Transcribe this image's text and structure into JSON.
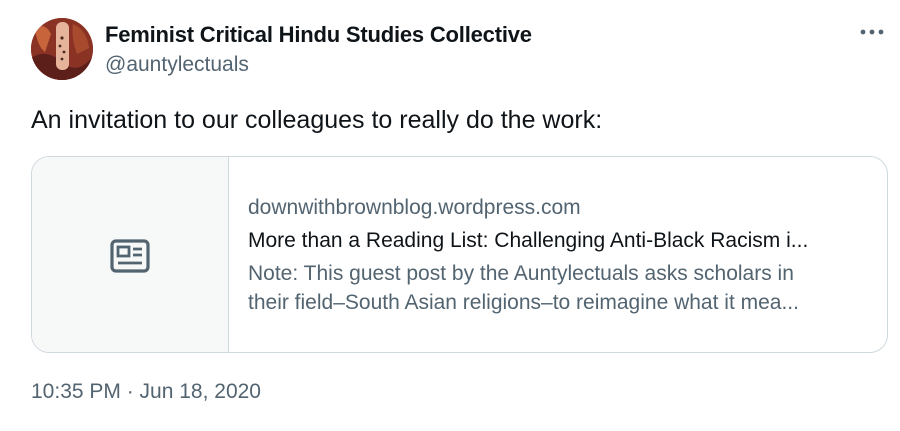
{
  "author": {
    "name": "Feminist Critical Hindu Studies Collective",
    "handle": "@auntylectuals"
  },
  "menu_icon": "more-horizontal-icon",
  "tweet": {
    "text": "An invitation to our colleagues to really do the work:"
  },
  "link_card": {
    "thumbnail_icon": "article-icon",
    "domain": "downwithbrownblog.wordpress.com",
    "title": "More than a Reading List: Challenging Anti-Black Racism i...",
    "description_line1": "Note: This guest post by the Auntylectuals asks scholars in",
    "description_line2": "their field–South Asian religions–to reimagine what it mea..."
  },
  "timestamp": "10:35 PM · Jun 18, 2020",
  "colors": {
    "primary_text": "#0f1419",
    "secondary_text": "#536471",
    "border": "#cfd9de",
    "thumb_bg": "#f7f9f9"
  }
}
